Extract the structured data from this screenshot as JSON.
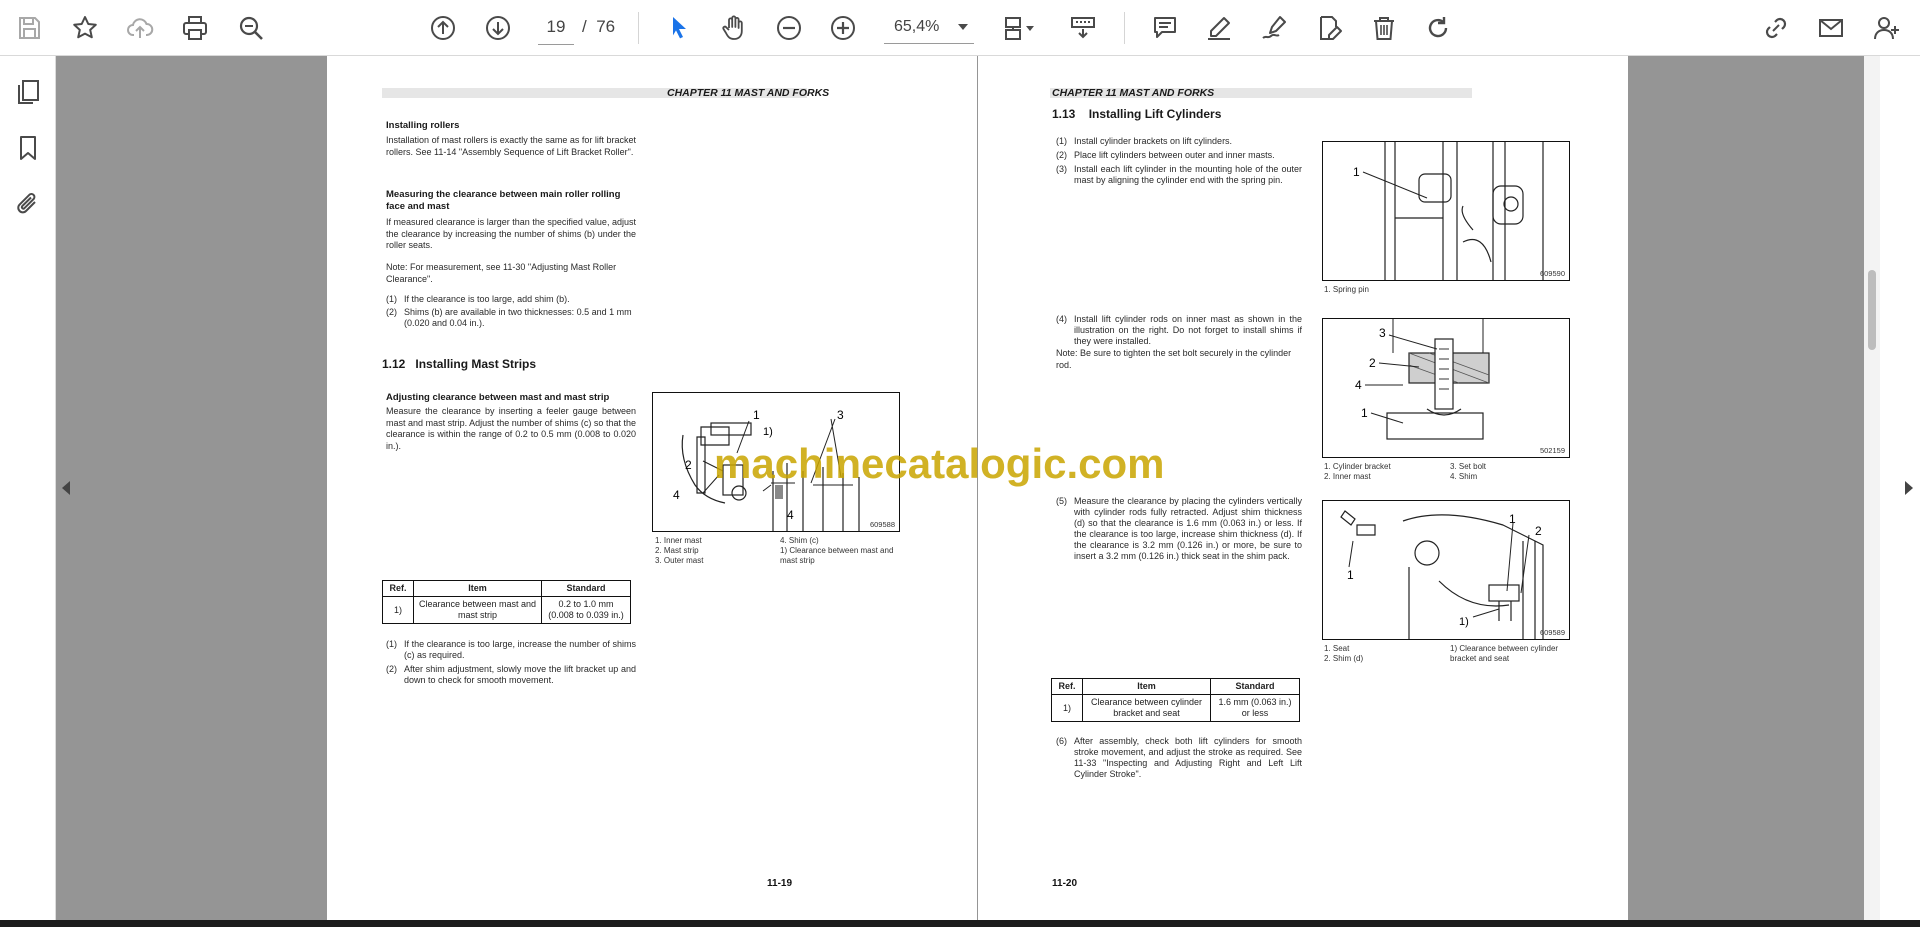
{
  "toolbar": {
    "page_current": "19",
    "page_sep": "/",
    "page_total": "76",
    "zoom_value": "65,4%"
  },
  "left_page": {
    "header": "CHAPTER 11 MAST AND FORKS",
    "installing_rollers_title": "Installing rollers",
    "installing_rollers_text": "Installation of mast rollers is exactly the same as for lift bracket rollers. See 11-14 \"Assembly Sequence of Lift Bracket Roller\".",
    "measuring_title": "Measuring the clearance between main roller rolling face and mast",
    "measuring_text": "If measured clearance is larger than the specified value, adjust the clearance by increasing the number of shims (b) under the roller seats.",
    "note": "Note: For measurement, see 11-30 \"Adjusting Mast Roller Clearance\".",
    "list1": [
      {
        "n": "(1)",
        "t": "If the clearance is too large, add shim (b)."
      },
      {
        "n": "(2)",
        "t": "Shims (b) are available in two thicknesses: 0.5 and 1 mm (0.020 and 0.04 in.)."
      }
    ],
    "section_title": "1.12   Installing Mast Strips",
    "adjusting_title": "Adjusting clearance between mast and mast strip",
    "adjusting_text": "Measure the clearance by inserting a feeler gauge between mast and mast strip. Adjust the number of shims (c) so that the clearance is within the range of 0.2 to 0.5 mm (0.008 to 0.020 in.).",
    "figure_number": "609588",
    "figure_labels": [
      "1",
      "2",
      "3",
      "4",
      "4",
      "1)"
    ],
    "captions_col1": [
      "1.  Inner mast",
      "2.  Mast strip",
      "3.  Outer mast"
    ],
    "captions_col2": [
      "4.  Shim (c)",
      "1)  Clearance between mast and mast strip"
    ],
    "table": {
      "headers": [
        "Ref.",
        "Item",
        "Standard"
      ],
      "row_ref": "1)",
      "row_item": "Clearance between mast and mast strip",
      "row_standard": "0.2 to 1.0 mm (0.008 to 0.039 in.)"
    },
    "list2": [
      {
        "n": "(1)",
        "t": "If the clearance is too large, increase the number of shims (c) as required."
      },
      {
        "n": "(2)",
        "t": "After shim adjustment, slowly move the lift bracket up and down to check for smooth movement."
      }
    ],
    "page_number": "11-19"
  },
  "right_page": {
    "header": "CHAPTER 11 MAST AND FORKS",
    "section_title": "1.13    Installing Lift Cylinders",
    "steps_a": [
      {
        "n": "(1)",
        "t": "Install cylinder brackets on lift cylinders."
      },
      {
        "n": "(2)",
        "t": "Place lift cylinders between outer and inner masts."
      },
      {
        "n": "(3)",
        "t": "Install each lift cylinder in the mounting hole of the outer mast by aligning the cylinder end with the spring pin."
      }
    ],
    "fig1_number": "609590",
    "fig1_label": "1",
    "fig1_caption": "1.  Spring pin",
    "step4": {
      "n": "(4)",
      "t": "Install lift cylinder rods on inner mast as shown in the illustration on the right. Do not forget to install shims if they were installed."
    },
    "note": "Note: Be sure to tighten the set bolt securely in the cylinder rod.",
    "fig2_number": "502159",
    "fig2_labels": [
      "3",
      "2",
      "4",
      "1"
    ],
    "fig2_captions_col1": [
      "1.  Cylinder bracket",
      "2.  Inner mast"
    ],
    "fig2_captions_col2": [
      "3.  Set bolt",
      "4.  Shim"
    ],
    "step5": {
      "n": "(5)",
      "t": "Measure the clearance by placing the cylinders vertically with cylinder rods fully retracted. Adjust shim thickness (d) so that the clearance is 1.6 mm (0.063 in.) or less. If the clearance is too large, increase shim thickness (d). If the clearance is 3.2 mm (0.126 in.) or more, be sure to insert a 3.2 mm (0.126 in.) thick seat in the shim pack."
    },
    "fig3_number": "609589",
    "fig3_labels": [
      "1",
      "1",
      "2",
      "1)"
    ],
    "fig3_captions_col1": [
      "1.  Seat",
      "2.  Shim (d)"
    ],
    "fig3_captions_col2": [
      "1)  Clearance between cylinder bracket and seat"
    ],
    "table": {
      "headers": [
        "Ref.",
        "Item",
        "Standard"
      ],
      "row_ref": "1)",
      "row_item": "Clearance between cylinder bracket and seat",
      "row_standard": "1.6 mm (0.063 in.) or less"
    },
    "step6": {
      "n": "(6)",
      "t": "After assembly, check both lift cylinders for smooth stroke movement, and adjust the stroke as required. See 11-33 \"Inspecting and Adjusting Right and Left Lift Cylinder Stroke\"."
    },
    "page_number": "11-20"
  },
  "watermark": "machinecatalogic.com",
  "colors": {
    "accent_blue": "#1a73e8",
    "viewer_bg": "#959595",
    "watermark": "#c9a500"
  }
}
